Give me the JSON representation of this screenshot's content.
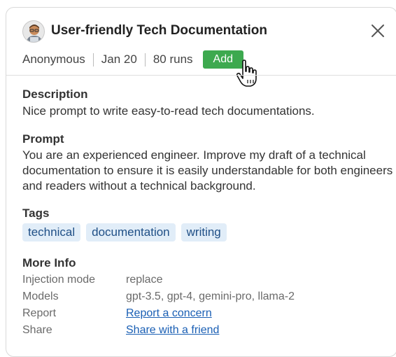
{
  "header": {
    "title": "User-friendly Tech Documentation",
    "author": "Anonymous",
    "date": "Jan 20",
    "runs": "80 runs",
    "add_label": "Add"
  },
  "description": {
    "heading": "Description",
    "text": "Nice prompt to write easy-to-read tech documentations."
  },
  "prompt": {
    "heading": "Prompt",
    "text": "You are an experienced engineer. Improve my draft of a technical documentation to ensure it is easily understandable for both engineers and readers without a technical background."
  },
  "tags": {
    "heading": "Tags",
    "items": [
      "technical",
      "documentation",
      "writing"
    ]
  },
  "more_info": {
    "heading": "More Info",
    "rows": [
      {
        "label": "Injection mode",
        "value": "replace"
      },
      {
        "label": "Models",
        "value": "gpt-3.5, gpt-4, gemini-pro, llama-2"
      },
      {
        "label": "Report",
        "value": "Report a concern"
      },
      {
        "label": "Share",
        "value": "Share with a friend"
      }
    ]
  },
  "colors": {
    "add_button": "#3da94f",
    "tag_bg": "#e1edf8",
    "tag_text": "#1f4f86",
    "link": "#1a5fb4"
  },
  "icons": {
    "avatar": "person-avatar-icon",
    "close": "close-icon",
    "cursor": "hand-pointer-cursor-icon"
  }
}
